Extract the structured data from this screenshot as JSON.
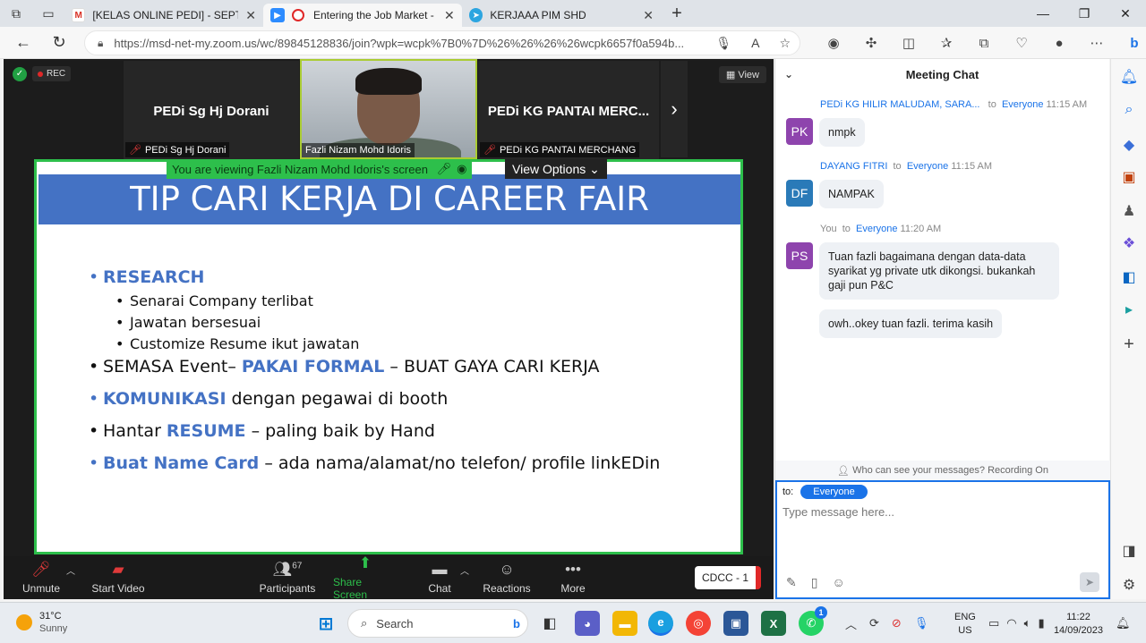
{
  "browser": {
    "tabs": [
      {
        "title": "[KELAS ONLINE PEDI] - SEPTEMB",
        "icon": "gmail-icon",
        "color": "#d93025",
        "glyph": "M"
      },
      {
        "title": "Entering the Job Market - In",
        "icon": "zoom-icon",
        "color": "#2d8cff",
        "glyph": "Z",
        "active": true
      },
      {
        "title": "KERJAAA PIM SHD",
        "icon": "telegram-icon",
        "color": "#2ca5e0",
        "glyph": "✈"
      }
    ],
    "url": "https://msd-net-my.zoom.us/wc/89845128836/join?wpk=wcpk%7B0%7D%26%26%26%26wcpk6657f0a594b..."
  },
  "zoom": {
    "rec_label": "REC",
    "view_label": "View",
    "tiles": [
      {
        "name": "PEDi Sg Hj Dorani",
        "label": "PEDi Sg Hj Dorani"
      },
      {
        "name": "PEDi KG PANTAI MERC...",
        "label": "PEDi KG PANTAI MERCHANG"
      }
    ],
    "video_label": "Fazli Nizam Mohd Idoris",
    "viewing_text": "You are viewing Fazli Nizam Mohd Idoris's screen",
    "view_options": "View Options",
    "slide": {
      "title": "TIP CARI KERJA DI CAREER FAIR",
      "research": "RESEARCH",
      "sub1": "Senarai Company terlibat",
      "sub2": "Jawatan bersesuai",
      "sub3": "Customize Resume ikut jawatan",
      "l2a": "SEMASA Event– ",
      "l2b": "PAKAI FORMAL",
      "l2c": " – BUAT GAYA CARI KERJA",
      "l3a": "KOMUNIKASI",
      "l3b": " dengan pegawai di booth",
      "l4a": "Hantar ",
      "l4b": "RESUME",
      "l4c": " – paling baik by Hand",
      "l5a": "Buat Name Card",
      "l5b": " – ada nama/alamat/no telefon/ profile linkEDin"
    },
    "toolbar": {
      "unmute": "Unmute",
      "start_video": "Start Video",
      "participants": "Participants",
      "participants_count": "67",
      "share_screen": "Share Screen",
      "chat": "Chat",
      "reactions": "Reactions",
      "more": "More",
      "cdcc": "CDCC - 1"
    }
  },
  "chat": {
    "title": "Meeting Chat",
    "to_word": "to",
    "messages": [
      {
        "sender": "PEDi KG HILIR MALUDAM, SARA...",
        "to": "Everyone",
        "time": "11:15 AM",
        "initials": "PK",
        "color": "#8e44ad",
        "text": "nmpk"
      },
      {
        "sender": "DAYANG FITRI",
        "to": "Everyone",
        "time": "11:15 AM",
        "initials": "DF",
        "color": "#2a7ab8",
        "text": "NAMPAK"
      },
      {
        "sender": "You",
        "to": "Everyone",
        "time": "11:20 AM",
        "initials": "PS",
        "color": "#8e44ad",
        "text": "Tuan fazli bagaimana dengan data-data syarikat yg private utk dikongsi. bukankah gaji pun P&C",
        "text2": "owh..okey tuan fazli. terima kasih"
      }
    ],
    "footer": "Who can see your messages? Recording On",
    "to_label": "to:",
    "to_value": "Everyone",
    "placeholder": "Type message here..."
  },
  "taskbar": {
    "temp": "31°C",
    "weather": "Sunny",
    "search": "Search",
    "lang1": "ENG",
    "lang2": "US",
    "time": "11:22",
    "date": "14/09/2023",
    "whatsapp_badge": "1"
  }
}
